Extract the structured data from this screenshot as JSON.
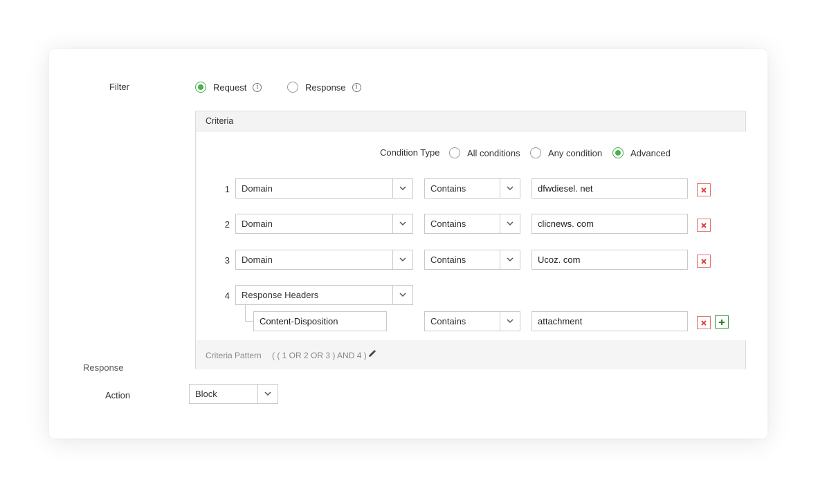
{
  "filter": {
    "label": "Filter",
    "options": [
      {
        "label": "Request",
        "selected": true
      },
      {
        "label": "Response",
        "selected": false
      }
    ]
  },
  "criteria": {
    "title": "Criteria",
    "condition_type_label": "Condition Type",
    "condition_types": [
      {
        "label": "All conditions",
        "selected": false
      },
      {
        "label": "Any condition",
        "selected": false
      },
      {
        "label": "Advanced",
        "selected": true
      }
    ],
    "rows": [
      {
        "num": "1",
        "field": "Domain",
        "operator": "Contains",
        "value": "dfwdiesel. net"
      },
      {
        "num": "2",
        "field": "Domain",
        "operator": "Contains",
        "value": "clicnews. com"
      },
      {
        "num": "3",
        "field": "Domain",
        "operator": "Contains",
        "value": "Ucoz. com"
      },
      {
        "num": "4",
        "field": "Response Headers",
        "header_name": "Content-Disposition",
        "operator": "Contains",
        "value": "attachment"
      }
    ],
    "pattern_label": "Criteria Pattern",
    "pattern_value": "( ( 1 OR 2 OR 3 ) AND 4 )"
  },
  "response": {
    "label": "Response",
    "action_label": "Action",
    "action_value": "Block"
  },
  "colors": {
    "accent_green": "#4caf50",
    "delete_red": "#e53935",
    "add_green": "#2e7d32"
  },
  "icons": {
    "info": "info-icon",
    "dropdown": "chevron-down-icon",
    "delete": "close-icon",
    "add": "plus-icon",
    "edit": "pencil-icon"
  }
}
